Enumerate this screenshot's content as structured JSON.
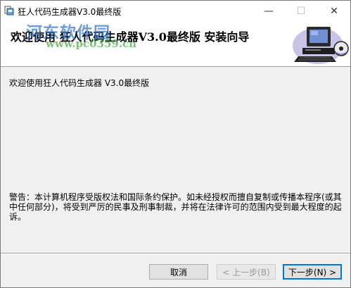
{
  "window": {
    "title": "狂人代码生成器V3.0最终版",
    "controls": {
      "minimize": "—",
      "maximize": "☐",
      "close": "✕"
    }
  },
  "header": {
    "title": "欢迎使用 狂人代码生成器V3.0最终版 安装向导",
    "watermark_main": "河东软件园",
    "watermark_url": "www.pc0359.cn",
    "art_icon": "computer-with-disc-icon"
  },
  "body": {
    "welcome": "欢迎使用狂人代码生成器 V3.0最终版",
    "copyright": "警告：本计算机程序受版权法和国际条约保护。如未经授权而擅自复制或传播本程序(或其中任何部分)，将受到严厉的民事及刑事制裁，并将在法律许可的范围内受到最大程度的起诉。"
  },
  "buttons": {
    "cancel": "取消",
    "back": "< 上一步(B)",
    "next": "下一步(N) >"
  },
  "colors": {
    "accent": "#0078d7",
    "window_bg": "#f0f0f0",
    "watermark_blue": "#3478cc",
    "watermark_green": "#46aa46"
  }
}
